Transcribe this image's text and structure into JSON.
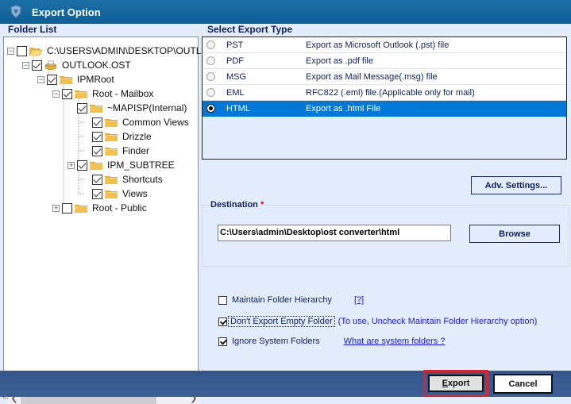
{
  "window": {
    "title": "Export Option"
  },
  "folder_list": {
    "title": "Folder List",
    "items": [
      {
        "label": "C:\\USERS\\ADMIN\\DESKTOP\\OUTLOOK",
        "checked": false,
        "expander": "minus",
        "icon": "open-folder"
      },
      {
        "label": "OUTLOOK.OST",
        "checked": true,
        "expander": "minus",
        "icon": "ost-file"
      },
      {
        "label": "IPMRoot",
        "checked": true,
        "expander": "minus",
        "icon": "folder"
      },
      {
        "label": "Root - Mailbox",
        "checked": true,
        "expander": "minus",
        "icon": "folder"
      },
      {
        "label": "~MAPISP(Internal)",
        "checked": true,
        "expander": "none",
        "icon": "folder"
      },
      {
        "label": "Common Views",
        "checked": true,
        "expander": "none",
        "icon": "folder"
      },
      {
        "label": "Drizzle",
        "checked": true,
        "expander": "none",
        "icon": "folder"
      },
      {
        "label": "Finder",
        "checked": true,
        "expander": "none",
        "icon": "folder"
      },
      {
        "label": "IPM_SUBTREE",
        "checked": true,
        "expander": "plus",
        "icon": "folder"
      },
      {
        "label": "Shortcuts",
        "checked": true,
        "expander": "none",
        "icon": "folder"
      },
      {
        "label": "Views",
        "checked": true,
        "expander": "none",
        "icon": "folder"
      },
      {
        "label": "Root - Public",
        "checked": false,
        "expander": "plus",
        "icon": "folder"
      }
    ]
  },
  "export_type": {
    "title": "Select Export Type",
    "options": [
      {
        "type": "PST",
        "description": "Export as Microsoft Outlook (.pst) file",
        "selected": false
      },
      {
        "type": "PDF",
        "description": "Export as .pdf file",
        "selected": false
      },
      {
        "type": "MSG",
        "description": "Export as Mail Message(.msg) file",
        "selected": false
      },
      {
        "type": "EML",
        "description": "RFC822 (.eml) file.(Applicable only for mail)",
        "selected": false
      },
      {
        "type": "HTML",
        "description": "Export as .html File",
        "selected": true
      }
    ]
  },
  "adv_settings_label": "Adv. Settings...",
  "destination": {
    "title": "Destination",
    "required_mark": "*",
    "path": "C:\\Users\\admin\\Desktop\\ost converter\\html",
    "browse_label": "Browse"
  },
  "options": {
    "maintain_hierarchy": {
      "label": "Maintain Folder Hierarchy",
      "checked": false,
      "help": "[?]"
    },
    "dont_export_empty": {
      "label": "Don't Export Empty Folder",
      "checked": true,
      "note": "(To use, Uncheck Maintain Folder Hierarchy option)"
    },
    "ignore_system": {
      "label": "Ignore System Folders",
      "checked": true,
      "link": "What are system folders ?"
    }
  },
  "footer": {
    "export_label": "Export",
    "cancel_label": "Cancel"
  },
  "colors": {
    "title_bar": "#1d6ea6",
    "selection": "#0078d7",
    "footer": "#3b5f95",
    "highlight_border": "#d9232d"
  }
}
